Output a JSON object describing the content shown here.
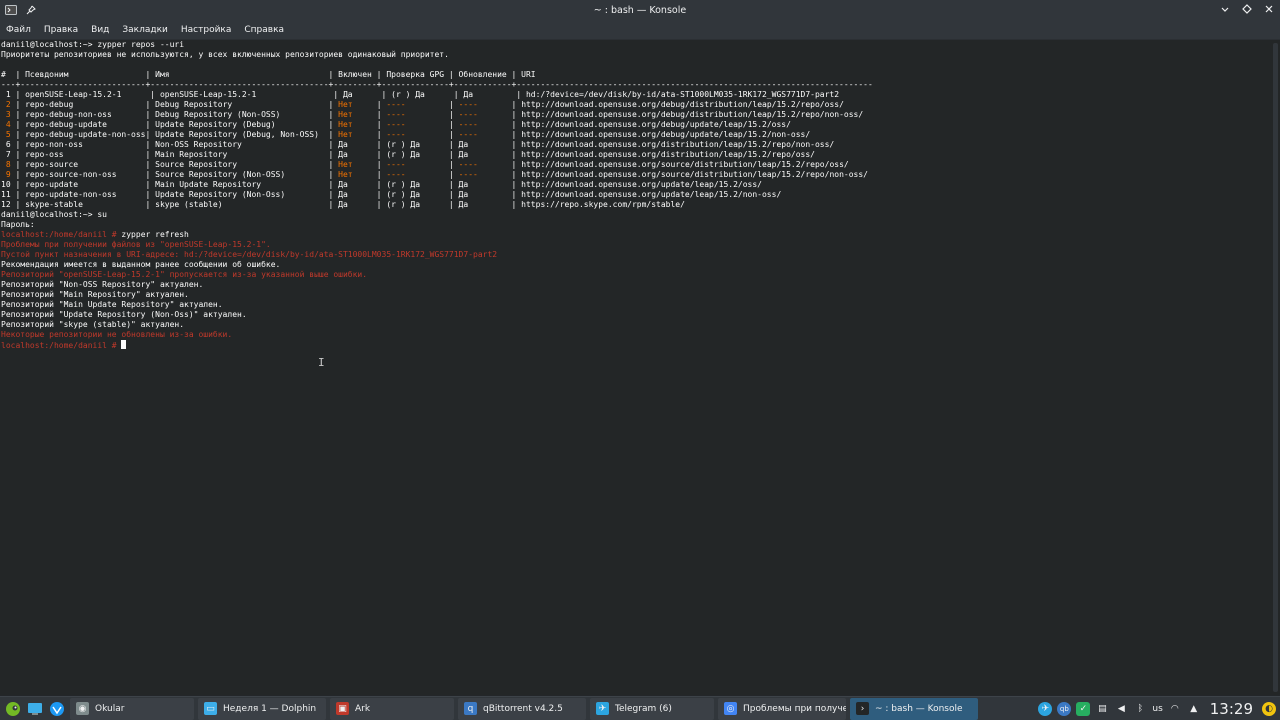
{
  "window": {
    "title": "~ : bash — Konsole"
  },
  "menu": [
    "Файл",
    "Правка",
    "Вид",
    "Закладки",
    "Настройка",
    "Справка"
  ],
  "terminal": {
    "lines": [
      {
        "segs": [
          {
            "t": "daniil@localhost:~> zypper repos --uri",
            "c": "white"
          }
        ]
      },
      {
        "segs": [
          {
            "t": "Приоритеты репозиториев не используются, у всех включенных репозиториев одинаковый приоритет.",
            "c": "white"
          }
        ]
      },
      {
        "segs": [
          {
            "t": "",
            "c": "white"
          }
        ]
      },
      {
        "segs": [
          {
            "t": "#  | Псевдоним                | Имя                                 | Включен | Проверка GPG | Обновление | URI",
            "c": "white"
          }
        ]
      },
      {
        "segs": [
          {
            "t": "---+--------------------------+-------------------------------------+---------+--------------+------------+--------------------------------------------------------------------------",
            "c": "white"
          }
        ]
      },
      {
        "segs": [
          {
            "t": " 1 | openSUSE-Leap-15.2-1      | openSUSE-Leap-15.2-1                | Да      | (r ) Да      | Да         | hd:/?device=/dev/disk/by-id/ata-ST1000LM035-1RK172_WGS771D7-part2",
            "c": "white"
          }
        ]
      },
      {
        "segs": [
          {
            "t": " 2",
            "c": "orange"
          },
          {
            "t": " | repo-debug               | Debug Repository                    | ",
            "c": "white"
          },
          {
            "t": "Нет",
            "c": "orange"
          },
          {
            "t": "     | ",
            "c": "white"
          },
          {
            "t": "----",
            "c": "orange"
          },
          {
            "t": "         | ",
            "c": "white"
          },
          {
            "t": "----",
            "c": "orange"
          },
          {
            "t": "       | http://download.opensuse.org/debug/distribution/leap/15.2/repo/oss/",
            "c": "white"
          }
        ]
      },
      {
        "segs": [
          {
            "t": " 3",
            "c": "orange"
          },
          {
            "t": " | repo-debug-non-oss       | Debug Repository (Non-OSS)          | ",
            "c": "white"
          },
          {
            "t": "Нет",
            "c": "orange"
          },
          {
            "t": "     | ",
            "c": "white"
          },
          {
            "t": "----",
            "c": "orange"
          },
          {
            "t": "         | ",
            "c": "white"
          },
          {
            "t": "----",
            "c": "orange"
          },
          {
            "t": "       | http://download.opensuse.org/debug/distribution/leap/15.2/repo/non-oss/",
            "c": "white"
          }
        ]
      },
      {
        "segs": [
          {
            "t": " 4",
            "c": "orange"
          },
          {
            "t": " | repo-debug-update        | Update Repository (Debug)           | ",
            "c": "white"
          },
          {
            "t": "Нет",
            "c": "orange"
          },
          {
            "t": "     | ",
            "c": "white"
          },
          {
            "t": "----",
            "c": "orange"
          },
          {
            "t": "         | ",
            "c": "white"
          },
          {
            "t": "----",
            "c": "orange"
          },
          {
            "t": "       | http://download.opensuse.org/debug/update/leap/15.2/oss/",
            "c": "white"
          }
        ]
      },
      {
        "segs": [
          {
            "t": " 5",
            "c": "orange"
          },
          {
            "t": " | repo-debug-update-non-oss| Update Repository (Debug, Non-OSS)  | ",
            "c": "white"
          },
          {
            "t": "Нет",
            "c": "orange"
          },
          {
            "t": "     | ",
            "c": "white"
          },
          {
            "t": "----",
            "c": "orange"
          },
          {
            "t": "         | ",
            "c": "white"
          },
          {
            "t": "----",
            "c": "orange"
          },
          {
            "t": "       | http://download.opensuse.org/debug/update/leap/15.2/non-oss/",
            "c": "white"
          }
        ]
      },
      {
        "segs": [
          {
            "t": " 6 | repo-non-oss             | Non-OSS Repository                  | Да      | (r ) Да      | Да         | http://download.opensuse.org/distribution/leap/15.2/repo/non-oss/",
            "c": "white"
          }
        ]
      },
      {
        "segs": [
          {
            "t": " 7 | repo-oss                 | Main Repository                     | Да      | (r ) Да      | Да         | http://download.opensuse.org/distribution/leap/15.2/repo/oss/",
            "c": "white"
          }
        ]
      },
      {
        "segs": [
          {
            "t": " 8",
            "c": "orange"
          },
          {
            "t": " | repo-source              | Source Repository                   | ",
            "c": "white"
          },
          {
            "t": "Нет",
            "c": "orange"
          },
          {
            "t": "     | ",
            "c": "white"
          },
          {
            "t": "----",
            "c": "orange"
          },
          {
            "t": "         | ",
            "c": "white"
          },
          {
            "t": "----",
            "c": "orange"
          },
          {
            "t": "       | http://download.opensuse.org/source/distribution/leap/15.2/repo/oss/",
            "c": "white"
          }
        ]
      },
      {
        "segs": [
          {
            "t": " 9",
            "c": "orange"
          },
          {
            "t": " | repo-source-non-oss      | Source Repository (Non-OSS)         | ",
            "c": "white"
          },
          {
            "t": "Нет",
            "c": "orange"
          },
          {
            "t": "     | ",
            "c": "white"
          },
          {
            "t": "----",
            "c": "orange"
          },
          {
            "t": "         | ",
            "c": "white"
          },
          {
            "t": "----",
            "c": "orange"
          },
          {
            "t": "       | http://download.opensuse.org/source/distribution/leap/15.2/repo/non-oss/",
            "c": "white"
          }
        ]
      },
      {
        "segs": [
          {
            "t": "10 | repo-update              | Main Update Repository              | Да      | (r ) Да      | Да         | http://download.opensuse.org/update/leap/15.2/oss/",
            "c": "white"
          }
        ]
      },
      {
        "segs": [
          {
            "t": "11 | repo-update-non-oss      | Update Repository (Non-Oss)         | Да      | (r ) Да      | Да         | http://download.opensuse.org/update/leap/15.2/non-oss/",
            "c": "white"
          }
        ]
      },
      {
        "segs": [
          {
            "t": "12 | skype-stable             | skype (stable)                      | Да      | (r ) Да      | Да         | https://repo.skype.com/rpm/stable/",
            "c": "white"
          }
        ]
      },
      {
        "segs": [
          {
            "t": "daniil@localhost:~> su",
            "c": "white"
          }
        ]
      },
      {
        "segs": [
          {
            "t": "Пароль:",
            "c": "white"
          }
        ]
      },
      {
        "segs": [
          {
            "t": "localhost:/home/daniil # ",
            "c": "red"
          },
          {
            "t": "zypper refresh",
            "c": "white"
          }
        ]
      },
      {
        "segs": [
          {
            "t": "Проблемы при получении файлов из \"openSUSE-Leap-15.2-1\".",
            "c": "red"
          }
        ]
      },
      {
        "segs": [
          {
            "t": "Пустой пункт назначения в URI-адресе: hd:/?device=/dev/disk/by-id/ata-ST1000LM035-1RK172_WGS771D7-part2",
            "c": "red"
          }
        ]
      },
      {
        "segs": [
          {
            "t": "Рекомендация имеется в выданном ранее сообщении об ошибке.",
            "c": "white"
          }
        ]
      },
      {
        "segs": [
          {
            "t": "Репозиторий \"openSUSE-Leap-15.2-1\" пропускается из-за указанной выше ошибки.",
            "c": "red"
          }
        ]
      },
      {
        "segs": [
          {
            "t": "Репозиторий \"Non-OSS Repository\" актуален.",
            "c": "white"
          }
        ]
      },
      {
        "segs": [
          {
            "t": "Репозиторий \"Main Repository\" актуален.",
            "c": "white"
          }
        ]
      },
      {
        "segs": [
          {
            "t": "Репозиторий \"Main Update Repository\" актуален.",
            "c": "white"
          }
        ]
      },
      {
        "segs": [
          {
            "t": "Репозиторий \"Update Repository (Non-Oss)\" актуален.",
            "c": "white"
          }
        ]
      },
      {
        "segs": [
          {
            "t": "Репозиторий \"skype (stable)\" актуален.",
            "c": "white"
          }
        ]
      },
      {
        "segs": [
          {
            "t": "Некоторые репозитории не обновлены из-за ошибки.",
            "c": "red"
          }
        ]
      },
      {
        "segs": [
          {
            "t": "localhost:/home/daniil # ",
            "c": "red"
          }
        ],
        "cursor": true
      }
    ]
  },
  "taskbar": {
    "tasks": [
      {
        "label": "Okular",
        "icon": "okular-icon",
        "active": false
      },
      {
        "label": "Неделя 1 — Dolphin",
        "icon": "folder-icon",
        "active": false
      },
      {
        "label": "Ark",
        "icon": "ark-icon",
        "active": false
      },
      {
        "label": "qBittorrent v4.2.5",
        "icon": "qbittorrent-icon",
        "active": false
      },
      {
        "label": "Telegram (6)",
        "icon": "telegram-icon",
        "active": false
      },
      {
        "label": "Проблемы при получе...",
        "icon": "chromium-icon",
        "active": false
      },
      {
        "label": "~ : bash — Konsole",
        "icon": "terminal-icon",
        "active": true
      }
    ],
    "keyboard_layout": "us",
    "clock": "13:29"
  },
  "colors": {
    "error": "#c0392b",
    "disabled": "#f67400",
    "text": "#fcfcfc",
    "background": "#232627"
  }
}
